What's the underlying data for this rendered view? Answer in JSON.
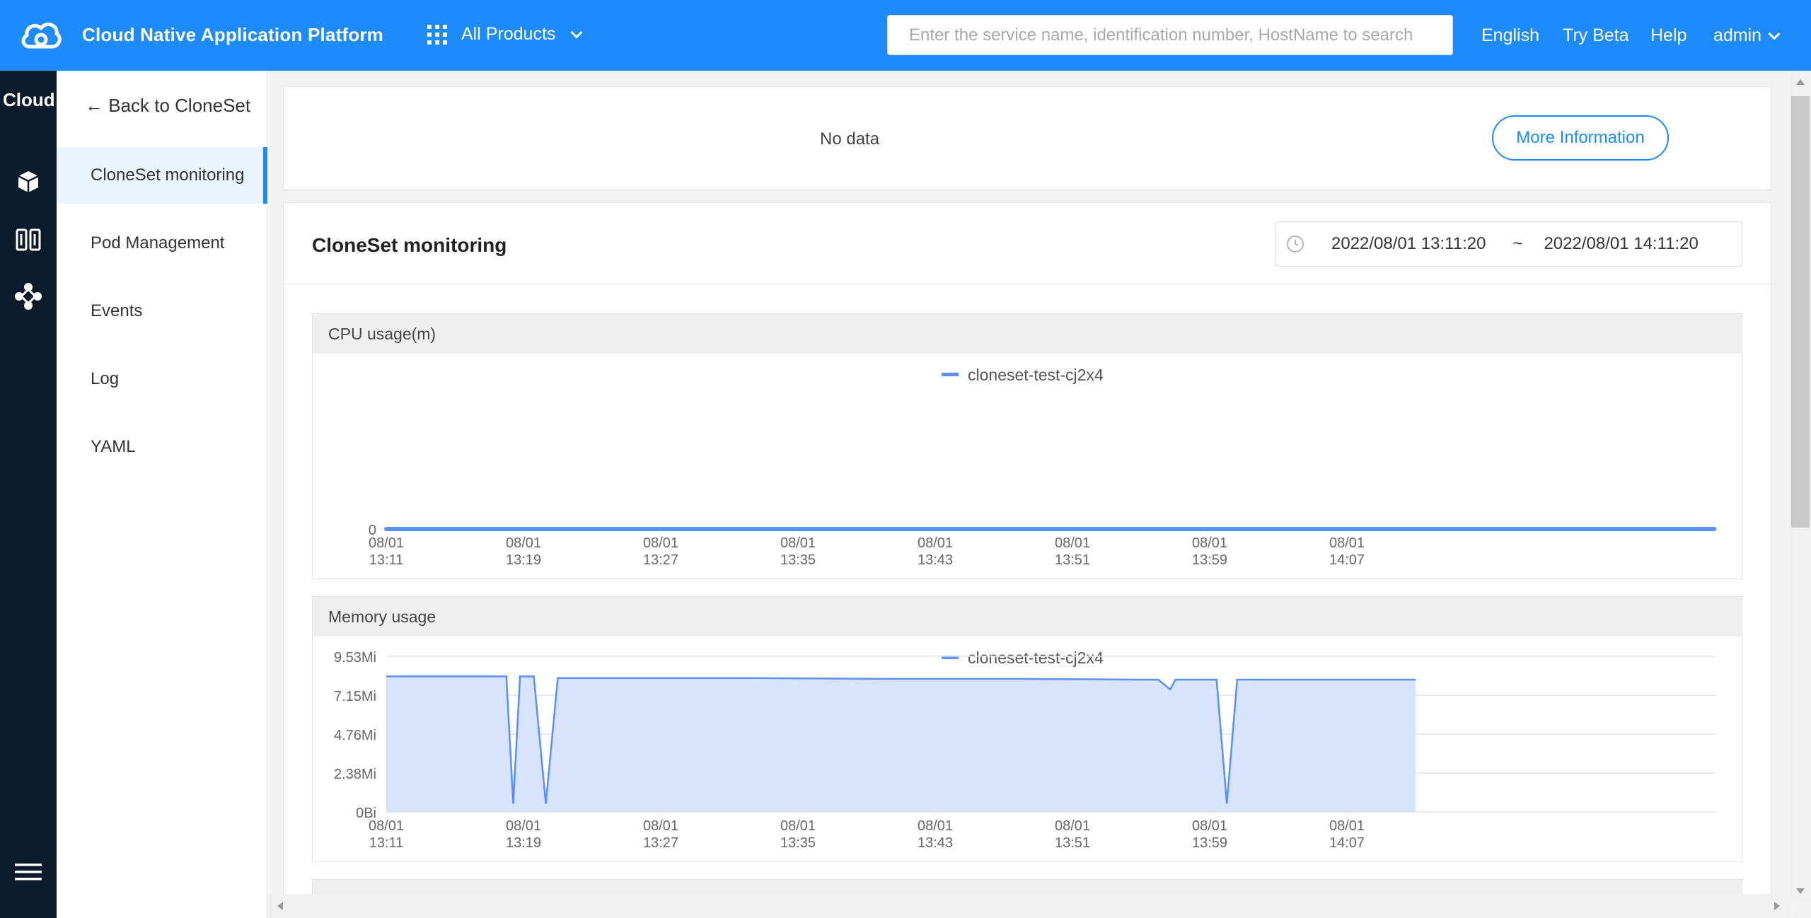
{
  "header": {
    "title": "Cloud Native Application Platform",
    "products_label": "All Products",
    "search_placeholder": "Enter the service name, identification number, HostName to search",
    "language": "English",
    "try_beta": "Try Beta",
    "help": "Help",
    "user": "admin"
  },
  "rail": {
    "brand": "Cloud",
    "icons": [
      "cube-icon",
      "columns-icon",
      "nodes-icon",
      "menu-icon"
    ]
  },
  "subnav": {
    "back_label": "← Back to CloneSet",
    "items": [
      {
        "label": "CloneSet monitoring",
        "active": true
      },
      {
        "label": "Pod Management",
        "active": false
      },
      {
        "label": "Events",
        "active": false
      },
      {
        "label": "Log",
        "active": false
      },
      {
        "label": "YAML",
        "active": false
      }
    ]
  },
  "info_card": {
    "message": "No data",
    "button": "More Information"
  },
  "monitoring": {
    "title": "CloneSet monitoring",
    "range_start": "2022/08/01 13:11:20",
    "range_sep": "~",
    "range_end": "2022/08/01 14:11:20"
  },
  "colors": {
    "accent": "#1e8bfd",
    "rail_bg": "#0c1b2b",
    "series_line": "#5b8ff9",
    "series_fill": "#d6e3fb"
  },
  "chart_data": [
    {
      "type": "line",
      "title": "CPU usage(m)",
      "series": [
        {
          "name": "cloneset-test-cj2x4",
          "values": [
            0,
            0,
            0,
            0,
            0,
            0,
            0,
            0
          ]
        }
      ],
      "x_ticks": [
        [
          "08/01",
          "13:11"
        ],
        [
          "08/01",
          "13:19"
        ],
        [
          "08/01",
          "13:27"
        ],
        [
          "08/01",
          "13:35"
        ],
        [
          "08/01",
          "13:43"
        ],
        [
          "08/01",
          "13:51"
        ],
        [
          "08/01",
          "13:59"
        ],
        [
          "08/01",
          "14:07"
        ]
      ],
      "y_ticks": [
        "0"
      ],
      "legend": "top-center"
    },
    {
      "type": "area",
      "title": "Memory usage",
      "series": [
        {
          "name": "cloneset-test-cj2x4",
          "x": [
            "13:11",
            "13:18",
            "13:18.4",
            "13:18.8",
            "13:19.6",
            "13:20.3",
            "13:21",
            "13:24",
            "13:32",
            "13:40",
            "13:48",
            "13:55",
            "13:56",
            "13:56.7",
            "13:57",
            "13:59.4",
            "13:60",
            "13:60.6",
            "14:07",
            "14:11"
          ],
          "values": [
            8.3,
            8.3,
            0.5,
            8.3,
            8.3,
            0.5,
            8.2,
            8.2,
            8.2,
            8.15,
            8.15,
            8.1,
            8.1,
            7.5,
            8.1,
            8.1,
            0.5,
            8.1,
            8.1,
            8.1
          ]
        }
      ],
      "x_ticks": [
        [
          "08/01",
          "13:11"
        ],
        [
          "08/01",
          "13:19"
        ],
        [
          "08/01",
          "13:27"
        ],
        [
          "08/01",
          "13:35"
        ],
        [
          "08/01",
          "13:43"
        ],
        [
          "08/01",
          "13:51"
        ],
        [
          "08/01",
          "13:59"
        ],
        [
          "08/01",
          "14:07"
        ]
      ],
      "y_ticks": [
        "9.53Mi",
        "7.15Mi",
        "4.76Mi",
        "2.38Mi",
        "0Bi"
      ],
      "ylim": [
        0,
        9.53
      ],
      "legend": "top-center"
    }
  ]
}
